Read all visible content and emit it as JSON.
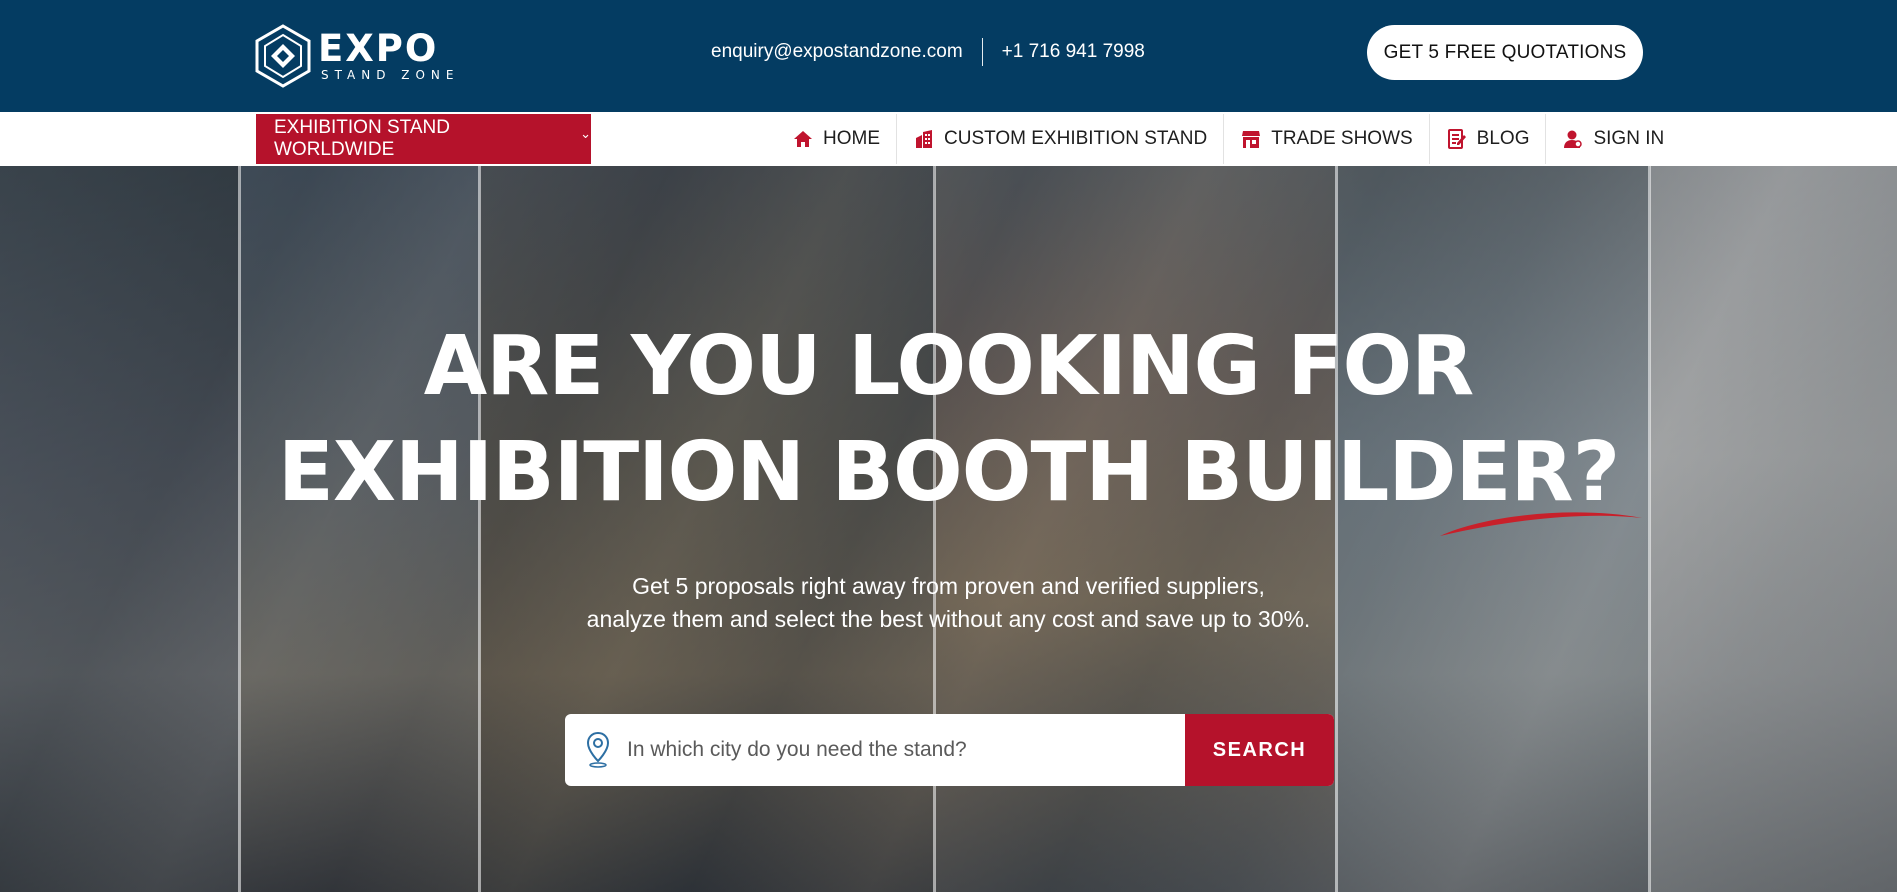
{
  "header": {
    "logo_main": "EXPO",
    "logo_sub": "STAND ZONE",
    "email": "enquiry@expostandzone.com",
    "phone": "+1 716 941 7998",
    "cta_label": "GET 5 FREE QUOTATIONS"
  },
  "nav": {
    "dropdown_label": "EXHIBITION STAND WORLDWIDE",
    "items": [
      {
        "label": "HOME",
        "icon": "home-icon"
      },
      {
        "label": "CUSTOM EXHIBITION STAND",
        "icon": "building-icon"
      },
      {
        "label": "TRADE SHOWS",
        "icon": "store-icon"
      },
      {
        "label": "BLOG",
        "icon": "blog-icon"
      },
      {
        "label": "SIGN IN",
        "icon": "user-icon"
      }
    ]
  },
  "hero": {
    "title_line1": "ARE YOU LOOKING FOR",
    "title_line2": "EXHIBITION BOOTH BUILDER?",
    "subtitle_line1": "Get 5 proposals right away from proven and verified suppliers,",
    "subtitle_line2": "analyze them and select the best without any cost and save up to 30%."
  },
  "search": {
    "placeholder": "In which city do you need the stand?",
    "value": "",
    "button_label": "SEARCH"
  },
  "colors": {
    "header_bg": "#043c62",
    "accent_red": "#b5122b",
    "white": "#ffffff"
  }
}
